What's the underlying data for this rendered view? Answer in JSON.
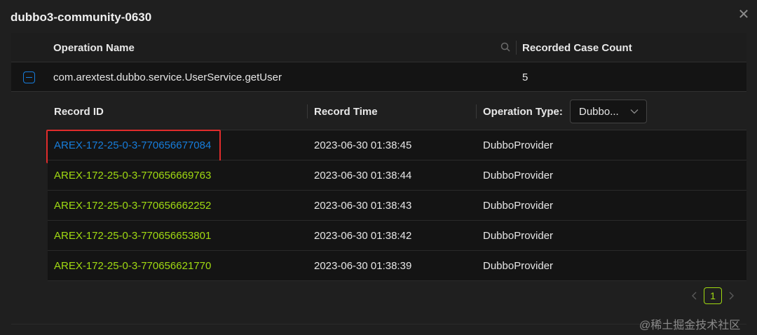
{
  "modal": {
    "title": "dubbo3-community-0630"
  },
  "outer_table": {
    "columns": {
      "operation_name": "Operation Name",
      "recorded_case_count": "Recorded Case Count"
    },
    "row": {
      "operation": "com.arextest.dubbo.service.UserService.getUser",
      "count": "5"
    }
  },
  "inner_table": {
    "columns": {
      "record_id": "Record ID",
      "record_time": "Record Time",
      "operation_type": "Operation Type:"
    },
    "filter": {
      "selected": "Dubbo..."
    },
    "rows": [
      {
        "id": "AREX-172-25-0-3-770656677084",
        "time": "2023-06-30 01:38:45",
        "type": "DubboProvider"
      },
      {
        "id": "AREX-172-25-0-3-770656669763",
        "time": "2023-06-30 01:38:44",
        "type": "DubboProvider"
      },
      {
        "id": "AREX-172-25-0-3-770656662252",
        "time": "2023-06-30 01:38:43",
        "type": "DubboProvider"
      },
      {
        "id": "AREX-172-25-0-3-770656653801",
        "time": "2023-06-30 01:38:42",
        "type": "DubboProvider"
      },
      {
        "id": "AREX-172-25-0-3-770656621770",
        "time": "2023-06-30 01:38:39",
        "type": "DubboProvider"
      }
    ]
  },
  "pagination": {
    "current": "1"
  },
  "watermark": "@稀土掘金技术社区",
  "icons": {
    "close": "close-icon",
    "search": "search-icon",
    "collapse": "minus-square-icon",
    "chevron": "chevron-down-icon",
    "prev": "left-arrow-icon",
    "next": "right-arrow-icon"
  },
  "colors": {
    "link_hover": "#177ddc",
    "link": "#a0d911",
    "highlight": "#e02c2c",
    "background": "#1f1f1f"
  }
}
